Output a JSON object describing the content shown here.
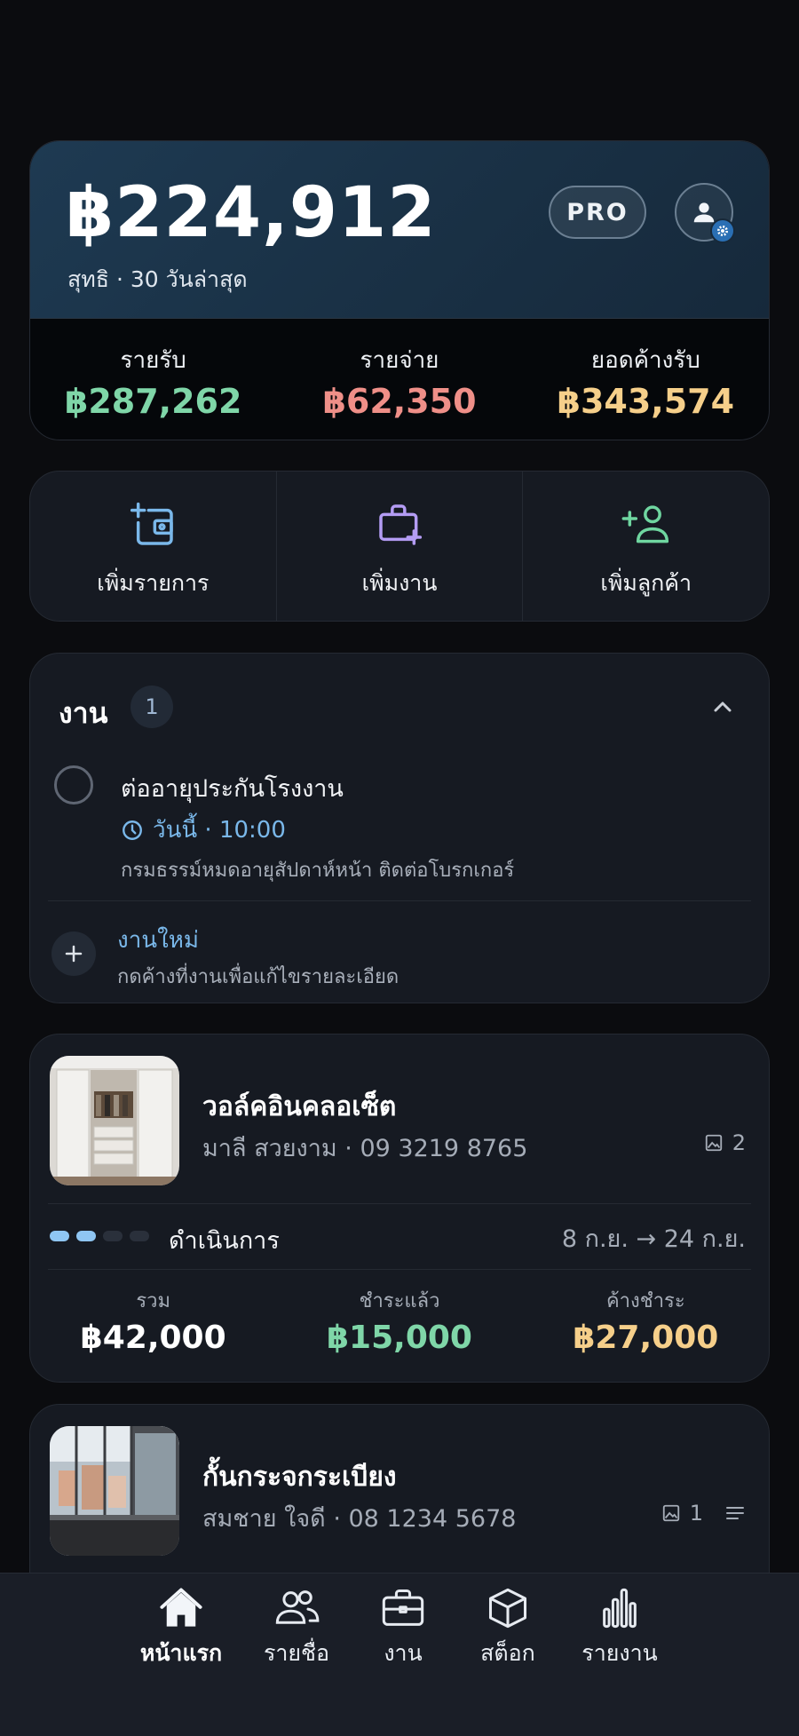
{
  "summary": {
    "net_amount": "฿224,912",
    "net_caption": "สุทธิ · 30 วันล่าสุด",
    "pro_label": "PRO",
    "income_label": "รายรับ",
    "income_value": "฿287,262",
    "expense_label": "รายจ่าย",
    "expense_value": "฿62,350",
    "receivable_label": "ยอดค้างรับ",
    "receivable_value": "฿343,574"
  },
  "actions": {
    "add_transaction": "เพิ่มรายการ",
    "add_job": "เพิ่มงาน",
    "add_customer": "เพิ่มลูกค้า"
  },
  "tasks": {
    "title": "งาน",
    "count": "1",
    "items": [
      {
        "title": "ต่ออายุประกันโรงงาน",
        "when": "วันนี้ · 10:00",
        "note": "กรมธรรม์หมดอายุสัปดาห์หน้า ติดต่อโบรกเกอร์"
      }
    ],
    "new_task_label": "งานใหม่",
    "new_task_hint": "กดค้างที่งานเพื่อแก้ไขรายละเอียด"
  },
  "jobs": [
    {
      "title": "วอล์คอินคลอเซ็ต",
      "customer": "มาลี สวยงาม",
      "phone": "· 09 3219 8765",
      "photos": "2",
      "progress_steps_done": 2,
      "progress_steps_total": 4,
      "status": "ดำเนินการ",
      "dates": "8 ก.ย. → 24 ก.ย.",
      "total_label": "รวม",
      "total_value": "฿42,000",
      "paid_label": "ชำระแล้ว",
      "paid_value": "฿15,000",
      "due_label": "ค้างชำระ",
      "due_value": "฿27,000"
    },
    {
      "title": "กั้นกระจกระเบียง",
      "customer": "สมชาย ใจดี",
      "phone": "· 08 1234 5678",
      "photos": "1"
    }
  ],
  "nav": {
    "home": "หน้าแรก",
    "contacts": "รายชื่อ",
    "jobs": "งาน",
    "stock": "สต็อก",
    "reports": "รายงาน"
  },
  "colors": {
    "income": "#7fd6a8",
    "expense": "#ef8f88",
    "receivable": "#f6cf8a",
    "accent_blue": "#7ab8ea",
    "accent_purple": "#b49cf4",
    "accent_green": "#6fd6a0"
  }
}
